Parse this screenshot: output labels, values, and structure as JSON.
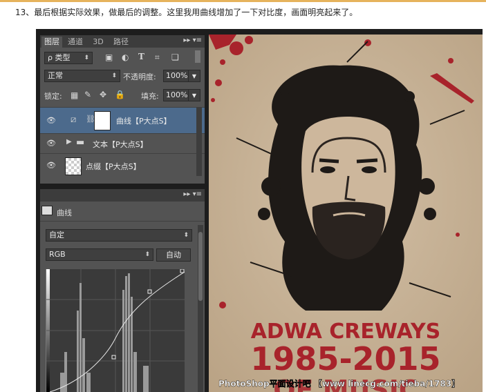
{
  "caption": "13、最后根据实际效果，做最后的调整。这里我用曲线增加了一下对比度，画面明亮起来了。",
  "layers_panel": {
    "tabs": [
      "图层",
      "通道",
      "3D",
      "路径"
    ],
    "panel_menu": "▸▸ ▾≡",
    "filter_kind": "ρ 类型",
    "blend_mode": "正常",
    "opacity_label": "不透明度:",
    "opacity_value": "100%",
    "lock_label": "锁定:",
    "fill_label": "填充:",
    "fill_value": "100%",
    "layers": [
      {
        "name": "曲线【P大点S】",
        "selected": true
      },
      {
        "name": "文本【P大点S】",
        "selected": false
      },
      {
        "name": "点缀【P大点S】",
        "selected": false
      }
    ]
  },
  "properties_panel": {
    "title": "曲线",
    "preset": "自定",
    "channel": "RGB",
    "auto_label": "自动"
  },
  "poster": {
    "name_text": "ADWA CREWAYS",
    "years_text": "1985-2015",
    "ghost_text": "OF MUSIC",
    "watermark": "PhotoShop平面设计吧 【www linecg.com/tieba/1783】",
    "colors": {
      "background": "#c7b299",
      "accent_red": "#a8232b",
      "ink": "#1e1a17"
    }
  }
}
